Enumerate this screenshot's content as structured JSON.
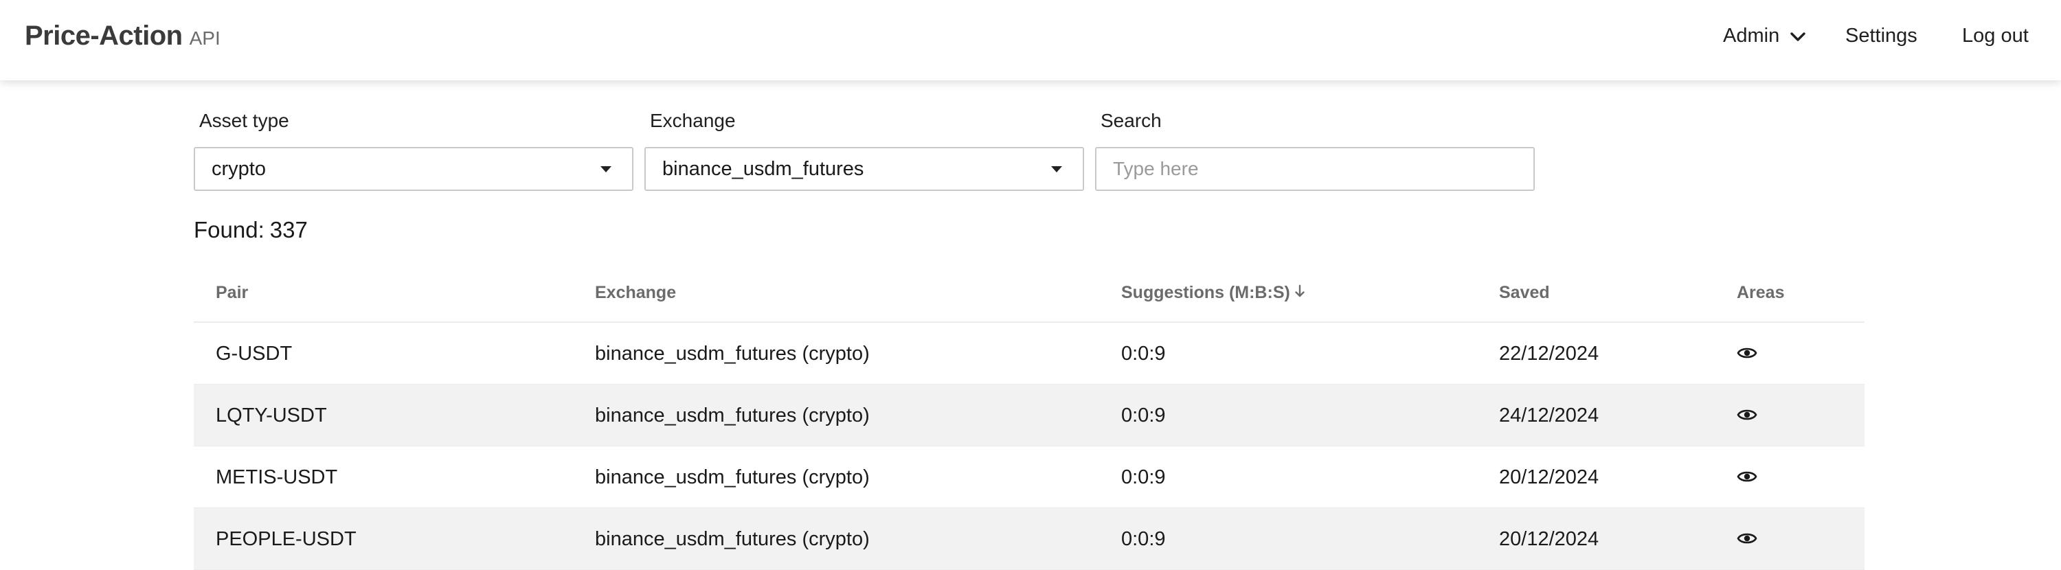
{
  "brand": {
    "name": "Price-Action",
    "sub": "API"
  },
  "nav": {
    "admin": "Admin",
    "settings": "Settings",
    "logout": "Log out"
  },
  "filters": {
    "asset_type": {
      "label": "Asset type",
      "value": "crypto"
    },
    "exchange": {
      "label": "Exchange",
      "value": "binance_usdm_futures"
    },
    "search": {
      "label": "Search",
      "placeholder": "Type here",
      "value": ""
    }
  },
  "found": {
    "label": "Found:",
    "count": "337"
  },
  "table": {
    "columns": {
      "pair": "Pair",
      "exchange": "Exchange",
      "suggestions": "Suggestions (M:B:S)",
      "saved": "Saved",
      "areas": "Areas"
    },
    "rows": [
      {
        "pair": "G-USDT",
        "exchange": "binance_usdm_futures (crypto)",
        "suggestions": "0:0:9",
        "saved": "22/12/2024"
      },
      {
        "pair": "LQTY-USDT",
        "exchange": "binance_usdm_futures (crypto)",
        "suggestions": "0:0:9",
        "saved": "24/12/2024"
      },
      {
        "pair": "METIS-USDT",
        "exchange": "binance_usdm_futures (crypto)",
        "suggestions": "0:0:9",
        "saved": "20/12/2024"
      },
      {
        "pair": "PEOPLE-USDT",
        "exchange": "binance_usdm_futures (crypto)",
        "suggestions": "0:0:9",
        "saved": "20/12/2024"
      }
    ]
  },
  "icons": {
    "admin_menu": "chevron-down-icon",
    "sort": "arrow-down-icon",
    "areas": "eye-icon",
    "select": "caret-down-icon"
  }
}
